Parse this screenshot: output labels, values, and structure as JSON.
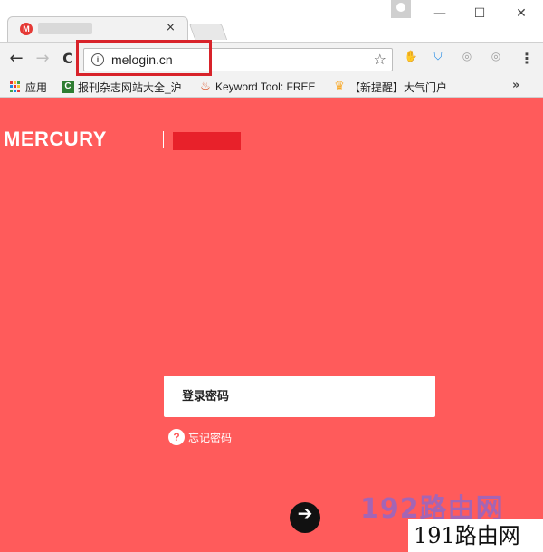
{
  "browser": {
    "tab": {
      "favicon_letter": "M",
      "close_label": "×"
    },
    "window_controls": {
      "minimize": "—",
      "maximize": "☐",
      "close": "✕"
    },
    "nav": {
      "back": "←",
      "forward": "→",
      "reload": "C"
    },
    "address": {
      "info": "i",
      "url": "melogin.cn",
      "star": "☆"
    },
    "extensions": [
      {
        "name": "hand-icon",
        "glyph": "✋",
        "color": "#9e9e9e"
      },
      {
        "name": "shield-icon",
        "glyph": "⛉",
        "color": "#1e88e5"
      },
      {
        "name": "extension-icon-1",
        "glyph": "◎",
        "color": "#9e9e9e"
      },
      {
        "name": "extension-icon-2",
        "glyph": "◎",
        "color": "#9e9e9e"
      }
    ],
    "menu_glyph": "⋮",
    "bookmarks": [
      {
        "label": "应用"
      },
      {
        "label": "报刊杂志网站大全_沪"
      },
      {
        "label": "Keyword Tool: FREE"
      },
      {
        "label": "【新提醒】大气门户"
      }
    ],
    "bookmarks_more": "»"
  },
  "page": {
    "brand": "MERCURY",
    "login": {
      "password_placeholder": "登录密码",
      "forgot_icon": "?",
      "forgot_label": "忘记密码",
      "submit_glyph": "➔"
    }
  },
  "watermarks": {
    "primary": "192路由网",
    "secondary": "191路由网"
  },
  "colors": {
    "page_background": "#ff5b5b",
    "highlight_border": "#d8232a",
    "redaction": "#e8212a"
  }
}
